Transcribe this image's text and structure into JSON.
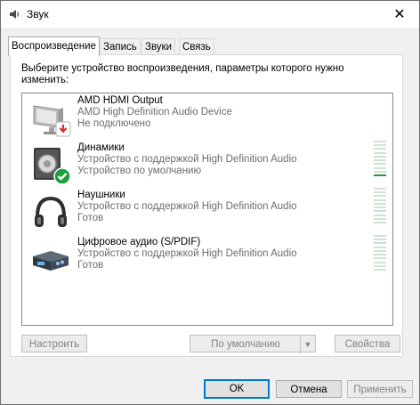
{
  "window": {
    "title": "Звук",
    "close_glyph": "✕"
  },
  "tabs": [
    {
      "label": "Воспроизведение",
      "active": true
    },
    {
      "label": "Запись",
      "active": false
    },
    {
      "label": "Звуки",
      "active": false
    },
    {
      "label": "Связь",
      "active": false
    }
  ],
  "panel": {
    "instruction": "Выберите устройство воспроизведения, параметры которого нужно изменить:"
  },
  "devices": [
    {
      "name": "AMD HDMI Output",
      "description": "AMD High Definition Audio Device",
      "status": "Не подключено",
      "icon": "monitor-icon",
      "badge": "red-down-arrow-badge",
      "level_active_segments": 0
    },
    {
      "name": "Динамики",
      "description": "Устройство с поддержкой High Definition Audio",
      "status": "Устройство по умолчанию",
      "icon": "speaker-icon",
      "badge": "green-check-badge",
      "level_active_segments": 1
    },
    {
      "name": "Наушники",
      "description": "Устройство с поддержкой High Definition Audio",
      "status": "Готов",
      "icon": "headphones-icon",
      "badge": "",
      "level_active_segments": 0
    },
    {
      "name": "Цифровое аудио (S/PDIF)",
      "description": "Устройство с поддержкой High Definition Audio",
      "status": "Готов",
      "icon": "digital-audio-icon",
      "badge": "",
      "level_active_segments": 0
    }
  ],
  "panel_buttons": {
    "configure": "Настроить",
    "set_default": "По умолчанию",
    "properties": "Свойства"
  },
  "dialog_buttons": {
    "ok": "OK",
    "cancel": "Отмена",
    "apply": "Применить"
  },
  "colors": {
    "accent": "#0078d7",
    "level_on": "#1f9a3b",
    "level_off": "#cfe3cf",
    "status_text": "#6d6d6d"
  }
}
